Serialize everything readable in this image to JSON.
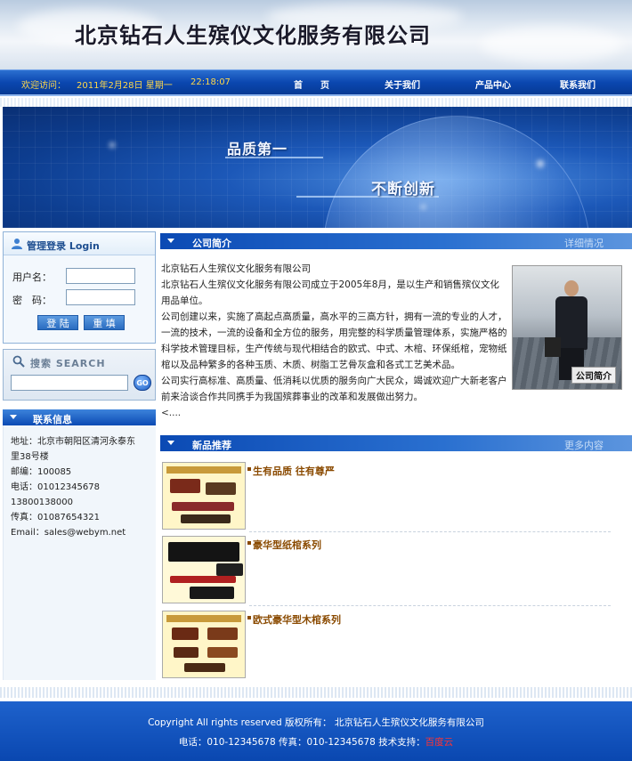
{
  "header": {
    "title": "北京钻石人生殡仪文化服务有限公司"
  },
  "navbar": {
    "welcome": "欢迎访问：",
    "date": "2011年2月28日 星期一",
    "time": "22:18:07",
    "items": [
      "首　　页",
      "关于我们",
      "产品中心",
      "联系我们"
    ]
  },
  "banner": {
    "slogan1": "品质第一",
    "slogan2": "不断创新"
  },
  "login": {
    "title": "管理登录 Login",
    "username_label": "用户名：",
    "password_label": "密　码：",
    "submit": "登 陆",
    "reset": "重 填"
  },
  "search": {
    "title": "搜索 SEARCH",
    "go": "GO"
  },
  "contact": {
    "title": "联系信息",
    "address_1": "地址：北京市朝阳区清河永泰东",
    "address_2": "里38号楼",
    "zip": "邮编：100085",
    "phone": "电话：01012345678",
    "mobile": "13800138000",
    "fax": "传真：01087654321",
    "email": "Email：sales@webym.net"
  },
  "about": {
    "title": "公司简介",
    "more": "详细情况",
    "company": "北京钻石人生殡仪文化服务有限公司",
    "para1": "北京钻石人生殡仪文化服务有限公司成立于2005年8月，是以生产和销售殡仪文化用品单位。",
    "para2": "公司创建以来，实施了高起点高质量，高水平的三高方针，拥有一流的专业的人才，一流的技术，一流的设备和全方位的服务，用完整的科学质量管理体系，实施严格的科学技术管理目标，生产传统与现代相结合的欧式、中式、木棺、环保纸棺，宠物纸棺以及品种繁多的各种玉质、木质、树脂工艺骨灰盒和各式工艺美术品。",
    "para3": "公司实行高标准、高质量、低消耗以优质的服务向广大民众，竭诚欢迎广大新老客户前来洽谈合作共同携手为我国殡葬事业的改革和发展做出努力。",
    "ellipsis": "<....",
    "photo_caption": "公司简介"
  },
  "products": {
    "title": "新品推荐",
    "more": "更多内容",
    "items": [
      {
        "name": "生有品质 往有尊严"
      },
      {
        "name": "豪华型纸棺系列"
      },
      {
        "name": "欧式豪华型木棺系列"
      }
    ]
  },
  "footer": {
    "copyright": "Copyright All rights reserved 版权所有： 北京钻石人生殡仪文化服务有限公司",
    "contact_line": "电话：010-12345678 传真：010-12345678 技术支持：",
    "support": "百度云"
  },
  "colors": {
    "primary_blue": "#0b47b0",
    "product_title": "#8a4a00",
    "accent_red": "#ff3333"
  }
}
